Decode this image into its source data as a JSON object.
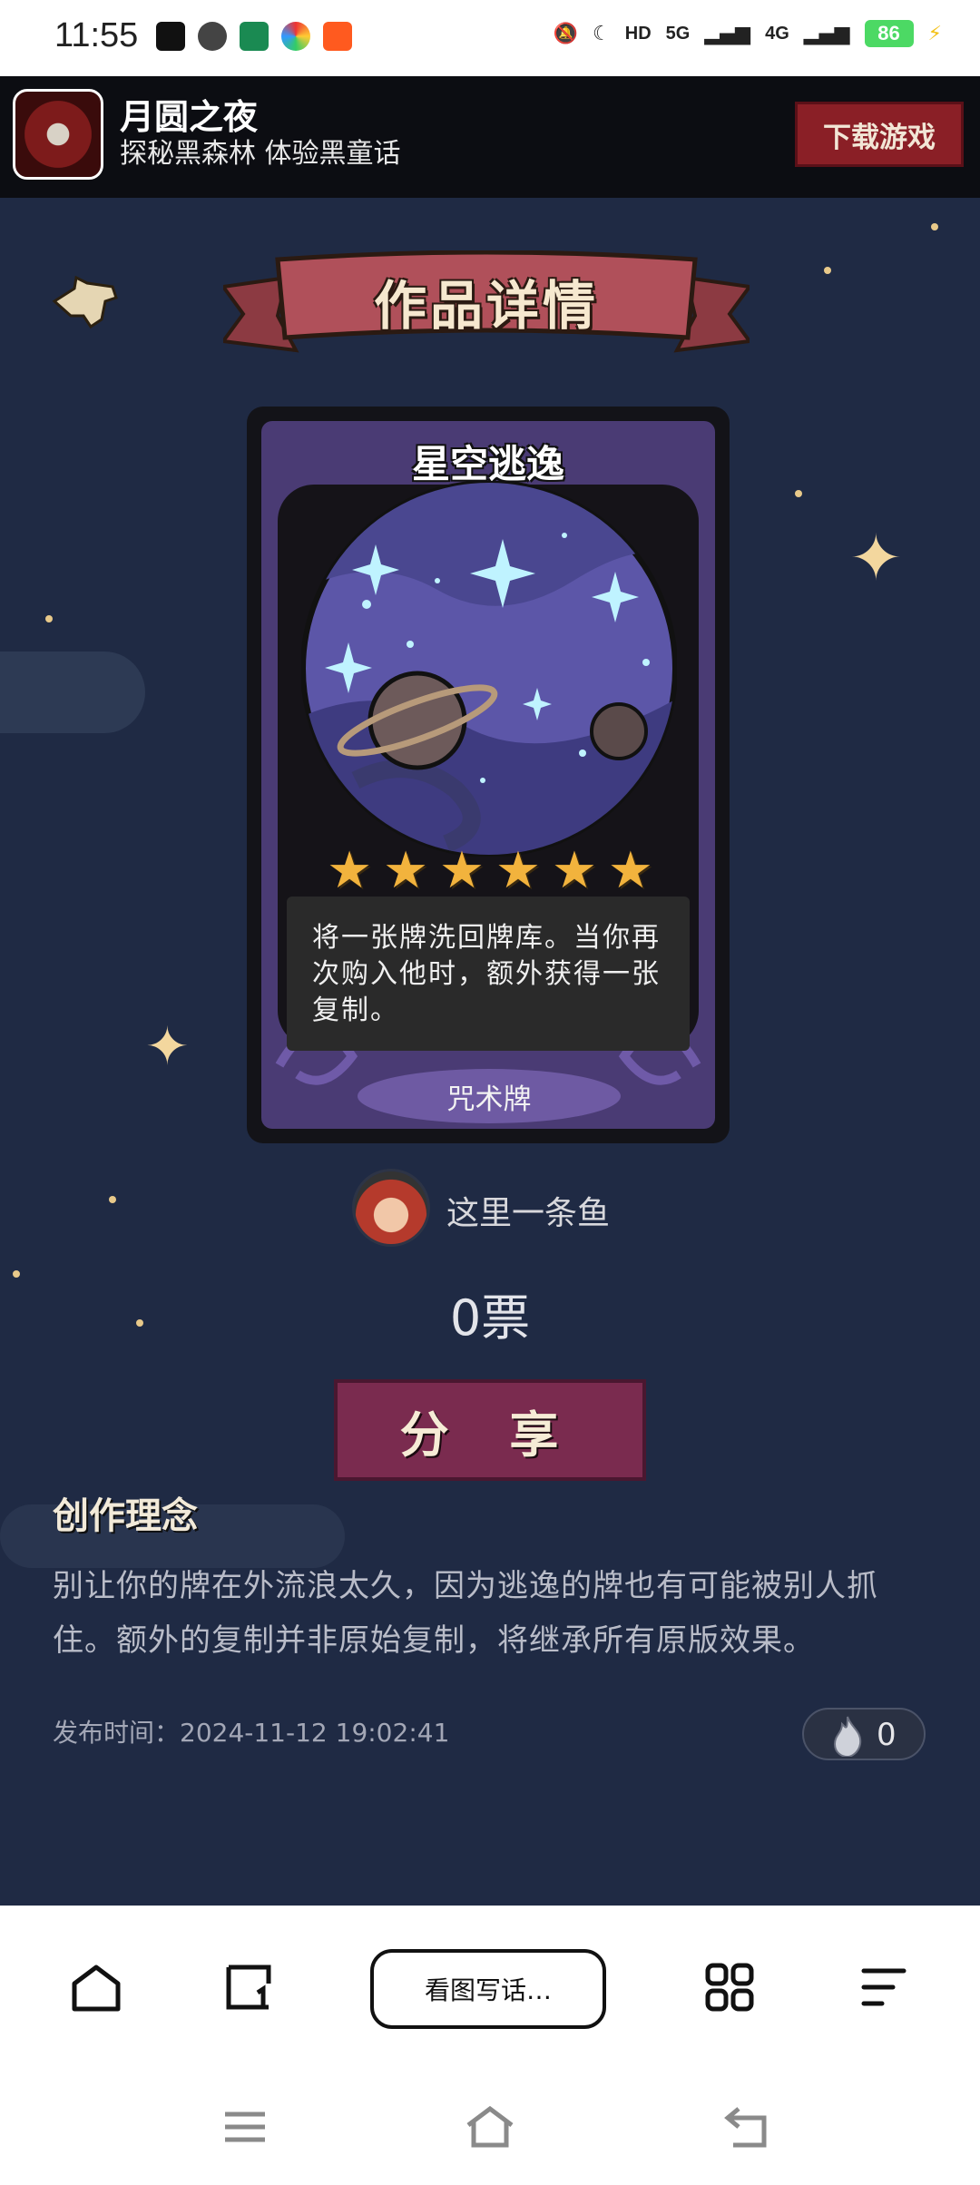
{
  "status_bar": {
    "time": "11:55",
    "battery": "86",
    "signal_5g": "5G",
    "signal_4g": "4G",
    "hd": "HD"
  },
  "ad": {
    "title": "月圆之夜",
    "subtitle": "探秘黑森林 体验黑童话",
    "button": "下载游戏"
  },
  "page": {
    "title": "作品详情"
  },
  "card": {
    "name": "星空逃逸",
    "stars": 6,
    "description": "将一张牌洗回牌库。当你再次购入他时，额外获得一张复制。",
    "type": "咒术牌"
  },
  "author": {
    "name": "这里一条鱼"
  },
  "votes": "0票",
  "share_button": "分 享",
  "concept": {
    "title": "创作理念",
    "text": "别让你的牌在外流浪太久，因为逃逸的牌也有可能被别人抓住。额外的复制并非原始复制，将继承所有原版效果。"
  },
  "publish": {
    "time": "发布时间：2024-11-12 19:02:41"
  },
  "hot": {
    "count": "0"
  },
  "browser": {
    "search_label": "看图写话…"
  },
  "colors": {
    "background": "#1f2a44",
    "card_purple": "#4a3b74",
    "share_button": "#7a2b4f",
    "star": "#f2b33d"
  }
}
